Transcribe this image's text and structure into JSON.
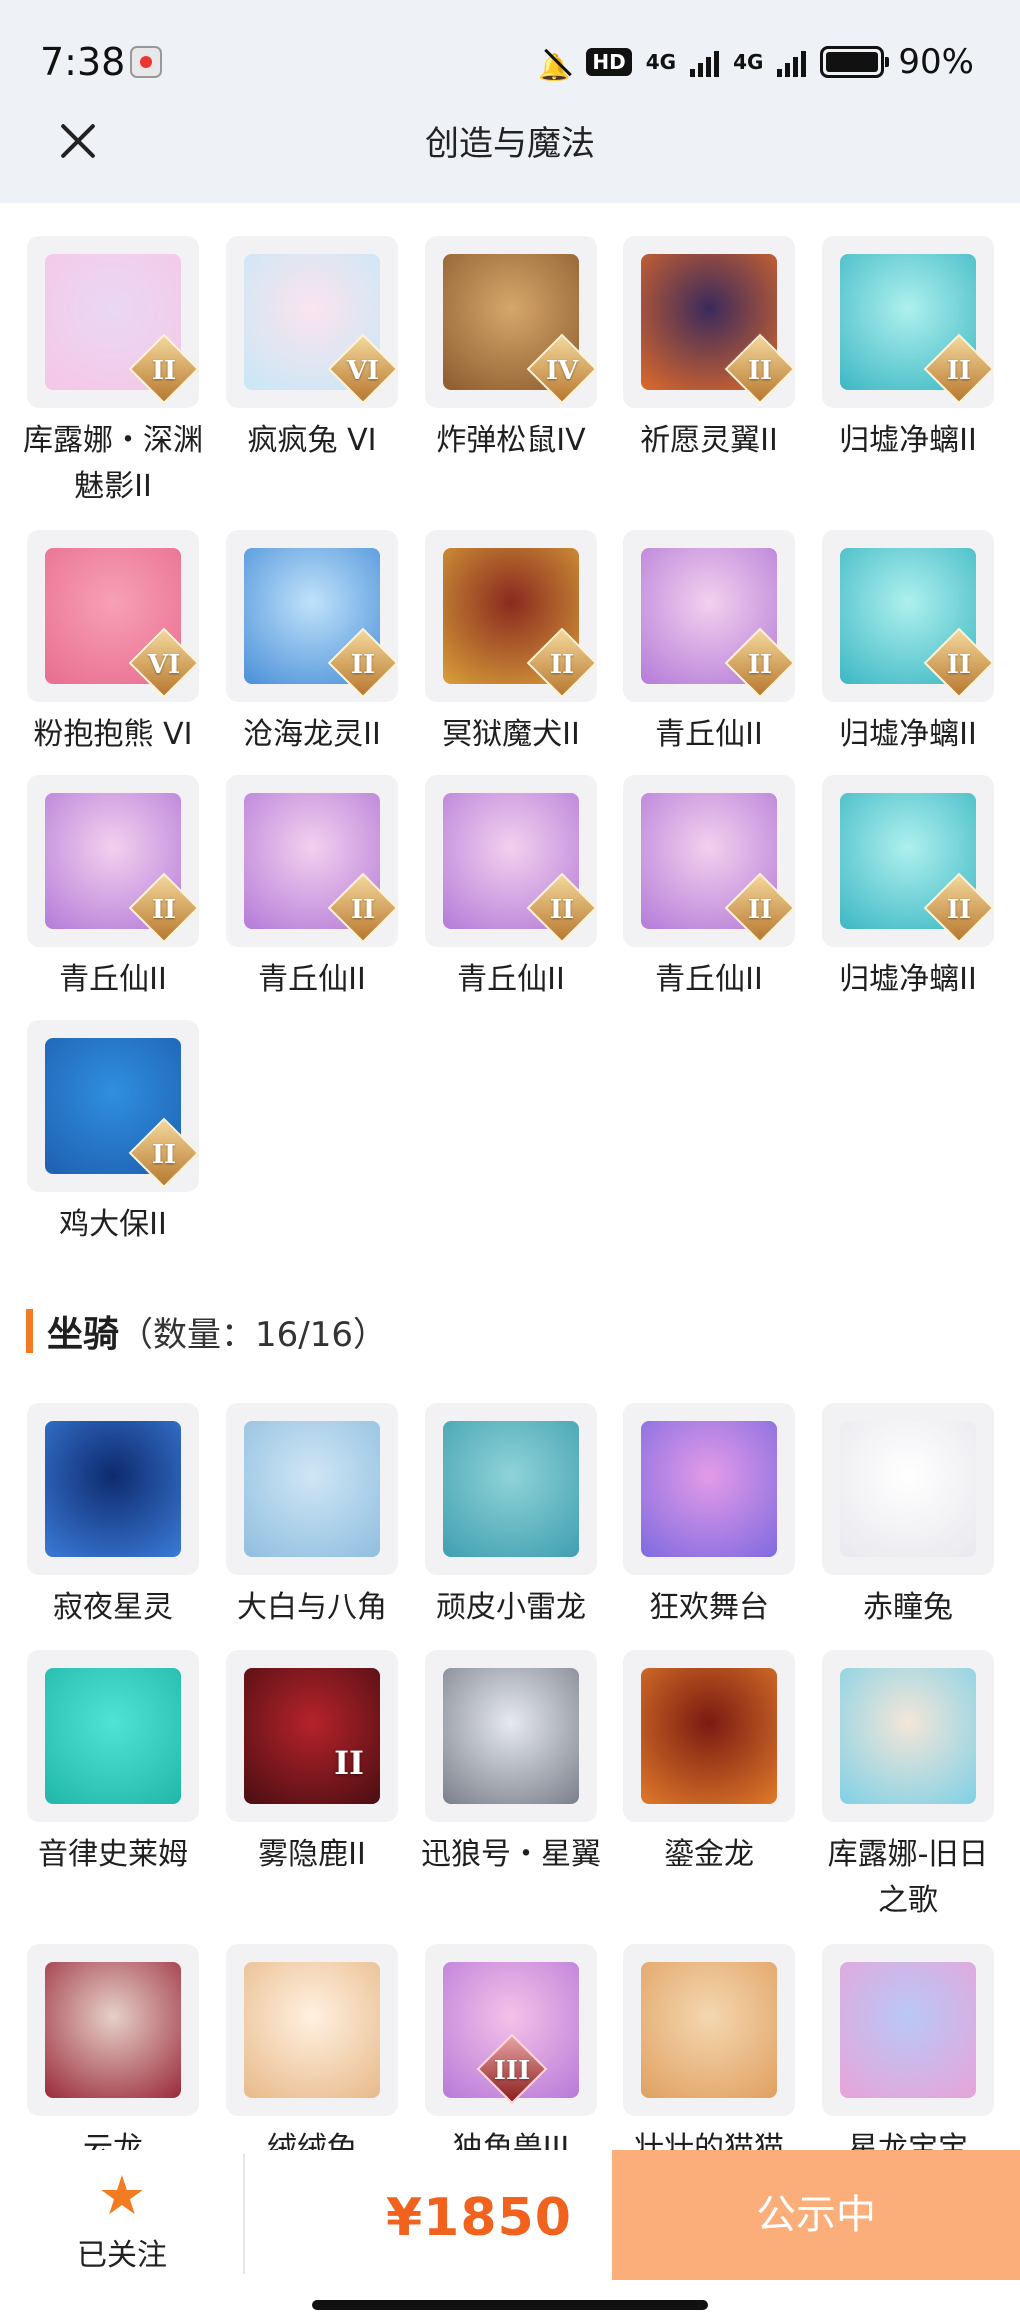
{
  "status_bar": {
    "time": "7:38",
    "hd_label": "HD",
    "net1": "4G",
    "net2": "4G",
    "battery": "90%"
  },
  "header": {
    "title": "创造与魔法"
  },
  "pets": {
    "items": [
      {
        "label": "库露娜・深渊魅影II",
        "rank": "II",
        "colors": [
          "#e9d8f4",
          "#f6c6e6"
        ],
        "icon": "character-portrait"
      },
      {
        "label": "疯疯兔 VI",
        "rank": "VI",
        "colors": [
          "#fbe4ee",
          "#c7e7f7"
        ],
        "icon": "rabbit-portrait"
      },
      {
        "label": "炸弹松鼠IV",
        "rank": "IV",
        "colors": [
          "#d6a76b",
          "#8c5b2e"
        ],
        "icon": "squirrel-portrait"
      },
      {
        "label": "祈愿灵翼II",
        "rank": "II",
        "colors": [
          "#3a2a5c",
          "#e06a2a"
        ],
        "icon": "bird-portrait"
      },
      {
        "label": "归墟净螭II",
        "rank": "II",
        "colors": [
          "#aef0ee",
          "#3cb7c3"
        ],
        "icon": "dragon-portrait"
      },
      {
        "label": "粉抱抱熊 VI",
        "rank": "VI",
        "colors": [
          "#f7a0b6",
          "#e86d8f"
        ],
        "icon": "bear-portrait"
      },
      {
        "label": "沧海龙灵II",
        "rank": "II",
        "colors": [
          "#bfe2fa",
          "#4a8fd8"
        ],
        "icon": "character-portrait"
      },
      {
        "label": "冥狱魔犬II",
        "rank": "II",
        "colors": [
          "#8a2a1f",
          "#d9a03a"
        ],
        "icon": "hound-portrait"
      },
      {
        "label": "青丘仙II",
        "rank": "II",
        "colors": [
          "#f3d0ee",
          "#b47bd8"
        ],
        "icon": "fox-fairy-portrait"
      },
      {
        "label": "归墟净螭II",
        "rank": "II",
        "colors": [
          "#aef0ee",
          "#3cb7c3"
        ],
        "icon": "dragon-portrait"
      },
      {
        "label": "青丘仙II",
        "rank": "II",
        "colors": [
          "#f3d0ee",
          "#b47bd8"
        ],
        "icon": "fox-fairy-portrait"
      },
      {
        "label": "青丘仙II",
        "rank": "II",
        "colors": [
          "#f3d0ee",
          "#b47bd8"
        ],
        "icon": "fox-fairy-portrait"
      },
      {
        "label": "青丘仙II",
        "rank": "II",
        "colors": [
          "#f3d0ee",
          "#b47bd8"
        ],
        "icon": "fox-fairy-portrait"
      },
      {
        "label": "青丘仙II",
        "rank": "II",
        "colors": [
          "#f3d0ee",
          "#b47bd8"
        ],
        "icon": "fox-fairy-portrait"
      },
      {
        "label": "归墟净螭II",
        "rank": "II",
        "colors": [
          "#aef0ee",
          "#3cb7c3"
        ],
        "icon": "dragon-portrait"
      },
      {
        "label": "鸡大保II",
        "rank": "II",
        "colors": [
          "#2f8fe0",
          "#1f5fb0"
        ],
        "icon": "bird-portrait"
      }
    ]
  },
  "mounts_section": {
    "title": "坐骑",
    "count": "（数量：16/16）"
  },
  "mounts": {
    "items": [
      {
        "label": "寂夜星灵",
        "rank": "",
        "colors": [
          "#0e2a6e",
          "#3a7bd8"
        ],
        "icon": "horse-portrait"
      },
      {
        "label": "大白与八角",
        "rank": "",
        "colors": [
          "#cfe6f5",
          "#8fbedf"
        ],
        "icon": "whale-portrait"
      },
      {
        "label": "顽皮小雷龙",
        "rank": "",
        "colors": [
          "#8fd3d8",
          "#3f9fb0"
        ],
        "icon": "dinosaur-portrait"
      },
      {
        "label": "狂欢舞台",
        "rank": "",
        "colors": [
          "#e39be8",
          "#7f6ae0"
        ],
        "icon": "heart-stage-icon"
      },
      {
        "label": "赤瞳兔",
        "rank": "",
        "colors": [
          "#ffffff",
          "#e8e8ee"
        ],
        "icon": "rabbit-portrait"
      },
      {
        "label": "音律史莱姆",
        "rank": "",
        "colors": [
          "#4fe3d6",
          "#21b7a8"
        ],
        "icon": "slime-portrait"
      },
      {
        "label": "雾隐鹿II",
        "rank": "II",
        "colors": [
          "#b5232a",
          "#4a0e12"
        ],
        "icon": "deer-portrait"
      },
      {
        "label": "迅狼号・星翼",
        "rank": "",
        "colors": [
          "#e6e9ef",
          "#7a7f8a"
        ],
        "icon": "mecha-wolf-portrait"
      },
      {
        "label": "鎏金龙",
        "rank": "",
        "colors": [
          "#7a1a12",
          "#e07a2a"
        ],
        "icon": "dragon-portrait"
      },
      {
        "label": "库露娜-旧日之歌",
        "rank": "",
        "colors": [
          "#f3e6d8",
          "#7fd0e6"
        ],
        "icon": "character-portrait"
      },
      {
        "label": "云龙",
        "rank": "",
        "colors": [
          "#e6d0c8",
          "#9a2a3a"
        ],
        "icon": "dragon-portrait"
      },
      {
        "label": "绒绒兔",
        "rank": "",
        "colors": [
          "#fff1e0",
          "#e8b98a"
        ],
        "icon": "rabbit-portrait"
      },
      {
        "label": "独角兽III",
        "rank": "III",
        "colors": [
          "#f6c1e8",
          "#b77ad8"
        ],
        "icon": "unicorn-portrait"
      },
      {
        "label": "壮壮的猫猫",
        "rank": "",
        "colors": [
          "#f4d7b0",
          "#e0a060"
        ],
        "icon": "cat-portrait"
      },
      {
        "label": "星龙宝宝",
        "rank": "",
        "colors": [
          "#b9c8f7",
          "#e8a3d8"
        ],
        "icon": "dragon-portrait"
      }
    ]
  },
  "bottom_bar": {
    "follow_label": "已关注",
    "follow_icon": "star-icon",
    "price": "¥1850",
    "status_button": "公示中"
  },
  "accent_color": "#f37b21"
}
